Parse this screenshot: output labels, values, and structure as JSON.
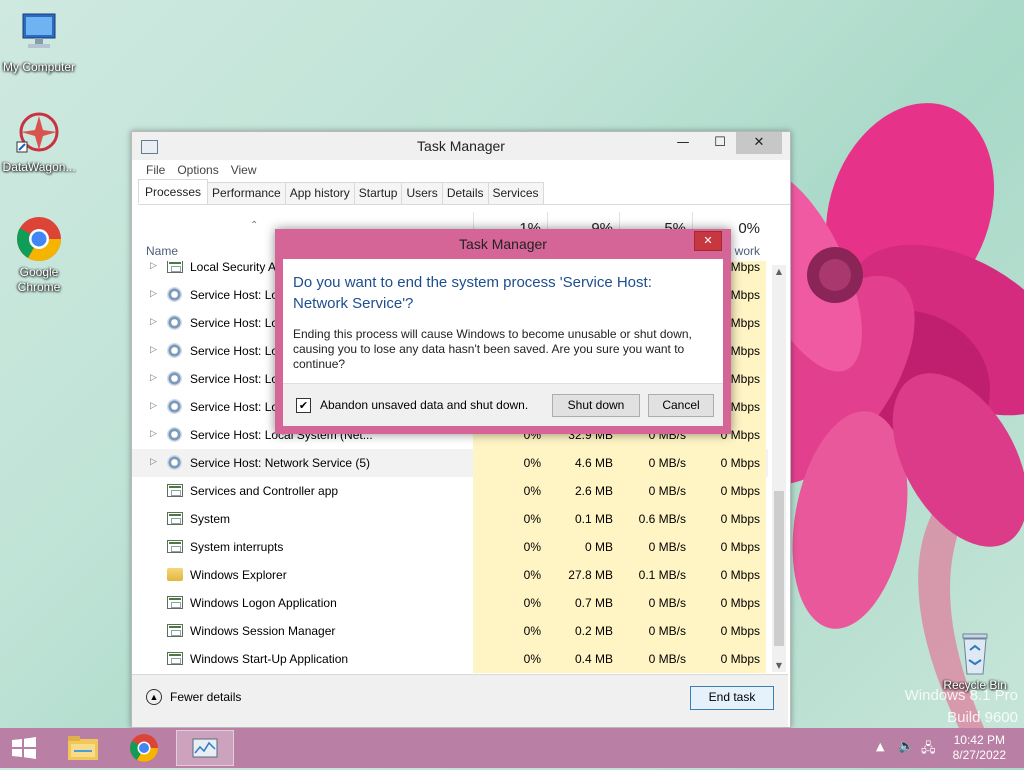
{
  "desktop": {
    "icons": [
      {
        "label": "My Computer"
      },
      {
        "label": "DataWagon..."
      },
      {
        "label": "Google Chrome"
      },
      {
        "label": "Recycle Bin"
      }
    ],
    "watermark_line1": "Windows 8.1 Pro",
    "watermark_line2": "Build 9600"
  },
  "task_manager": {
    "title": "Task Manager",
    "menu": [
      "File",
      "Options",
      "View"
    ],
    "tabs": [
      "Processes",
      "Performance",
      "App history",
      "Startup",
      "Users",
      "Details",
      "Services"
    ],
    "active_tab": "Processes",
    "columns": {
      "name": "Name",
      "cpu_pct": "1%",
      "mem_pct": "9%",
      "disk_pct": "5%",
      "net_pct": "0%",
      "net_label": "work"
    },
    "rows": [
      {
        "name": "Local Security Au",
        "expandable": true,
        "icon": "app-icon",
        "cpu": "",
        "mem": "",
        "disk": "",
        "net": "Mbps"
      },
      {
        "name": "Service Host: Loc",
        "expandable": true,
        "icon": "gear-icon",
        "cpu": "",
        "mem": "",
        "disk": "",
        "net": "Mbps"
      },
      {
        "name": "Service Host: Loc",
        "expandable": true,
        "icon": "gear-icon",
        "cpu": "",
        "mem": "",
        "disk": "",
        "net": "Mbps"
      },
      {
        "name": "Service Host: Loc",
        "expandable": true,
        "icon": "gear-icon",
        "cpu": "",
        "mem": "",
        "disk": "",
        "net": "Mbps"
      },
      {
        "name": "Service Host: Loc",
        "expandable": true,
        "icon": "gear-icon",
        "cpu": "",
        "mem": "",
        "disk": "",
        "net": "Mbps"
      },
      {
        "name": "Service Host: Loc",
        "expandable": true,
        "icon": "gear-icon",
        "cpu": "",
        "mem": "",
        "disk": "",
        "net": "Mbps"
      },
      {
        "name": "Service Host: Local System (Net...",
        "expandable": true,
        "icon": "gear-icon",
        "cpu": "0%",
        "mem": "32.9 MB",
        "disk": "0 MB/s",
        "net": "0 Mbps"
      },
      {
        "name": "Service Host: Network Service (5)",
        "expandable": true,
        "icon": "gear-icon",
        "cpu": "0%",
        "mem": "4.6 MB",
        "disk": "0 MB/s",
        "net": "0 Mbps",
        "selected": true
      },
      {
        "name": "Services and Controller app",
        "expandable": false,
        "icon": "app-icon",
        "cpu": "0%",
        "mem": "2.6 MB",
        "disk": "0 MB/s",
        "net": "0 Mbps"
      },
      {
        "name": "System",
        "expandable": false,
        "icon": "app-icon",
        "cpu": "0%",
        "mem": "0.1 MB",
        "disk": "0.6 MB/s",
        "net": "0 Mbps"
      },
      {
        "name": "System interrupts",
        "expandable": false,
        "icon": "app-icon",
        "cpu": "0%",
        "mem": "0 MB",
        "disk": "0 MB/s",
        "net": "0 Mbps"
      },
      {
        "name": "Windows Explorer",
        "expandable": false,
        "icon": "folder-icon",
        "cpu": "0%",
        "mem": "27.8 MB",
        "disk": "0.1 MB/s",
        "net": "0 Mbps"
      },
      {
        "name": "Windows Logon Application",
        "expandable": false,
        "icon": "app-icon",
        "cpu": "0%",
        "mem": "0.7 MB",
        "disk": "0 MB/s",
        "net": "0 Mbps"
      },
      {
        "name": "Windows Session Manager",
        "expandable": false,
        "icon": "app-icon",
        "cpu": "0%",
        "mem": "0.2 MB",
        "disk": "0 MB/s",
        "net": "0 Mbps"
      },
      {
        "name": "Windows Start-Up Application",
        "expandable": false,
        "icon": "app-icon",
        "cpu": "0%",
        "mem": "0.4 MB",
        "disk": "0 MB/s",
        "net": "0 Mbps"
      }
    ],
    "fewer_details": "Fewer details",
    "end_task": "End task"
  },
  "dialog": {
    "title": "Task Manager",
    "main_instruction": "Do you want to end the system process 'Service Host: Network Service'?",
    "detail": "Ending this process will cause Windows to become unusable or shut down, causing you to lose any data hasn't been saved. Are you sure you want to continue?",
    "checkbox_label": "Abandon unsaved data and shut down.",
    "checkbox_checked": true,
    "shutdown_label": "Shut down",
    "cancel_label": "Cancel"
  },
  "taskbar": {
    "time": "10:42 PM",
    "date": "8/27/2022"
  },
  "colors": {
    "accent_dialog": "#d66597",
    "taskbar": "#b97fa4",
    "heat_cell": "#fff4c4"
  }
}
